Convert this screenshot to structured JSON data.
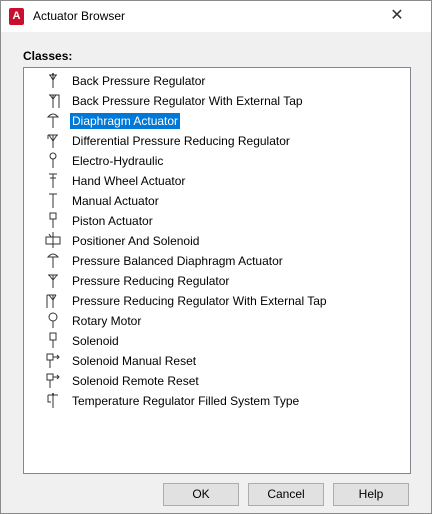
{
  "window": {
    "title": "Actuator Browser",
    "app_icon_text": "A",
    "close_glyph": "✕"
  },
  "classes_label": "Classes:",
  "items": [
    {
      "label": "Back Pressure Regulator",
      "icon": "back-pressure-regulator-icon",
      "selected": false
    },
    {
      "label": "Back Pressure Regulator With External Tap",
      "icon": "back-pressure-regulator-external-tap-icon",
      "selected": false
    },
    {
      "label": "Diaphragm Actuator",
      "icon": "diaphragm-actuator-icon",
      "selected": true
    },
    {
      "label": "Differential Pressure Reducing Regulator",
      "icon": "differential-pressure-regulator-icon",
      "selected": false
    },
    {
      "label": "Electro-Hydraulic",
      "icon": "electro-hydraulic-icon",
      "selected": false
    },
    {
      "label": "Hand Wheel Actuator",
      "icon": "hand-wheel-actuator-icon",
      "selected": false
    },
    {
      "label": "Manual Actuator",
      "icon": "manual-actuator-icon",
      "selected": false
    },
    {
      "label": "Piston Actuator",
      "icon": "piston-actuator-icon",
      "selected": false
    },
    {
      "label": "Positioner And Solenoid",
      "icon": "positioner-solenoid-icon",
      "selected": false
    },
    {
      "label": "Pressure Balanced Diaphragm Actuator",
      "icon": "pressure-balanced-diaphragm-icon",
      "selected": false
    },
    {
      "label": "Pressure Reducing Regulator",
      "icon": "pressure-reducing-regulator-icon",
      "selected": false
    },
    {
      "label": "Pressure Reducing Regulator With External Tap",
      "icon": "pressure-reducing-regulator-external-tap-icon",
      "selected": false
    },
    {
      "label": "Rotary Motor",
      "icon": "rotary-motor-icon",
      "selected": false
    },
    {
      "label": "Solenoid",
      "icon": "solenoid-icon",
      "selected": false
    },
    {
      "label": "Solenoid Manual Reset",
      "icon": "solenoid-manual-reset-icon",
      "selected": false
    },
    {
      "label": "Solenoid Remote Reset",
      "icon": "solenoid-remote-reset-icon",
      "selected": false
    },
    {
      "label": "Temperature Regulator Filled System Type",
      "icon": "temperature-regulator-icon",
      "selected": false
    }
  ],
  "buttons": {
    "ok": "OK",
    "cancel": "Cancel",
    "help": "Help"
  },
  "colors": {
    "selection": "#0078d7",
    "app_icon": "#c8102e"
  }
}
